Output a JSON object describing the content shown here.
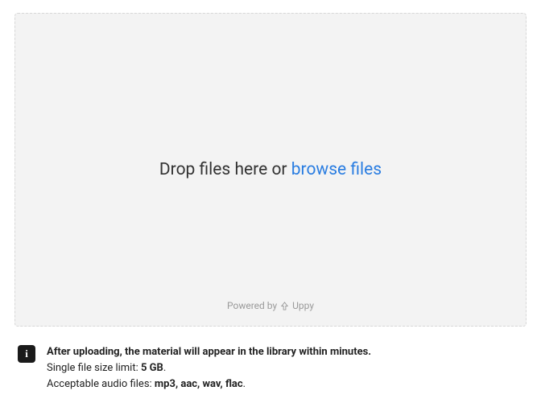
{
  "dropzone": {
    "prompt_prefix": "Drop files here or ",
    "browse_label": "browse files",
    "powered_prefix": "Powered by ",
    "powered_name": "Uppy"
  },
  "info": {
    "icon_glyph": "i",
    "headline": "After uploading, the material will appear in the library within minutes.",
    "size_limit_label": "Single file size limit: ",
    "size_limit_value": "5 GB",
    "size_limit_suffix": ".",
    "audio_label": "Acceptable audio files: ",
    "audio_value": "mp3, aac, wav, flac",
    "audio_suffix": "."
  }
}
